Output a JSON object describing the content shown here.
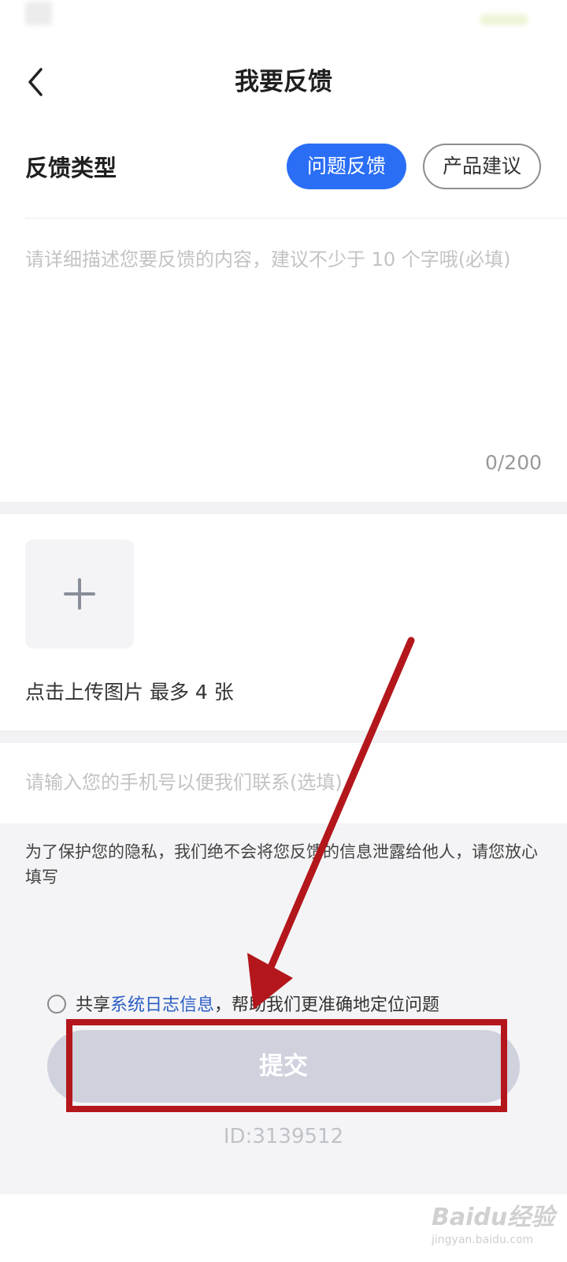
{
  "header": {
    "title": "我要反馈",
    "back_icon": "chevron-left-icon"
  },
  "feedback_type": {
    "label": "反馈类型",
    "options": [
      {
        "label": "问题反馈",
        "selected": true
      },
      {
        "label": "产品建议",
        "selected": false
      }
    ]
  },
  "description": {
    "placeholder": "请详细描述您要反馈的内容，建议不少于 10 个字哦(必填)",
    "counter": "0/200"
  },
  "upload": {
    "icon": "plus-icon",
    "hint": "点击上传图片 最多 4 张"
  },
  "contact": {
    "placeholder": "请输入您的手机号以便我们联系(选填)"
  },
  "privacy_note": "为了保护您的隐私，我们绝不会将您反馈的信息泄露给他人，请您放心填写",
  "share_logs": {
    "prefix": "共享",
    "link": "系统日志信息",
    "suffix": "，帮助我们更准确地定位问题",
    "checked": false
  },
  "submit": {
    "label": "提交"
  },
  "id_label": "ID:3139512",
  "watermark": {
    "logo": "Baidu经验",
    "url": "jingyan.baidu.com"
  },
  "colors": {
    "accent": "#2a6ef5",
    "annotation": "#b3171c",
    "submit_disabled": "#cfd1dd"
  }
}
